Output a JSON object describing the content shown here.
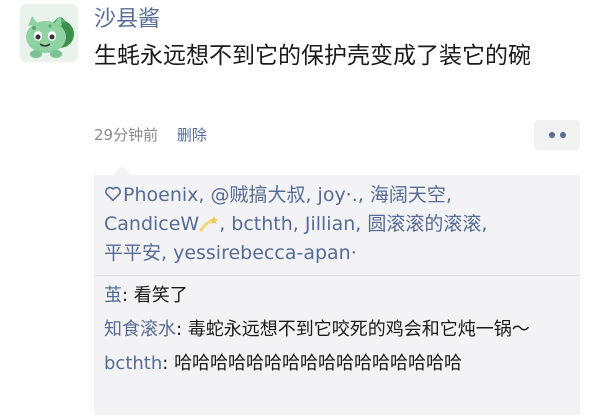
{
  "post": {
    "author": "沙县酱",
    "content": "生蚝永远想不到它的保护壳变成了装它的碗",
    "time": "29分钟前",
    "delete_label": "删除"
  },
  "likes": {
    "names_line1": "Phoenix, @贼搞大叔, joy·., 海阔天空,",
    "names_line2a": "CandiceW",
    "names_line2b": ", bcthth, Jillian, 圆滚滚的滚滚,",
    "names_line3": "平平安, yessirebecca-apan·"
  },
  "comments": [
    {
      "name": "茧",
      "sep": ": ",
      "text": "看笑了"
    },
    {
      "name": "知食滚水",
      "sep": ": ",
      "text": "毒蛇永远想不到它咬死的鸡会和它炖一锅～"
    },
    {
      "name": "bcthth",
      "sep": ": ",
      "text": "哈哈哈哈哈哈哈哈哈哈哈哈哈哈哈哈"
    }
  ],
  "colors": {
    "link": "#576b95",
    "panel_bg": "#f3f3f5",
    "avatar_green": "#8fd3a3"
  }
}
